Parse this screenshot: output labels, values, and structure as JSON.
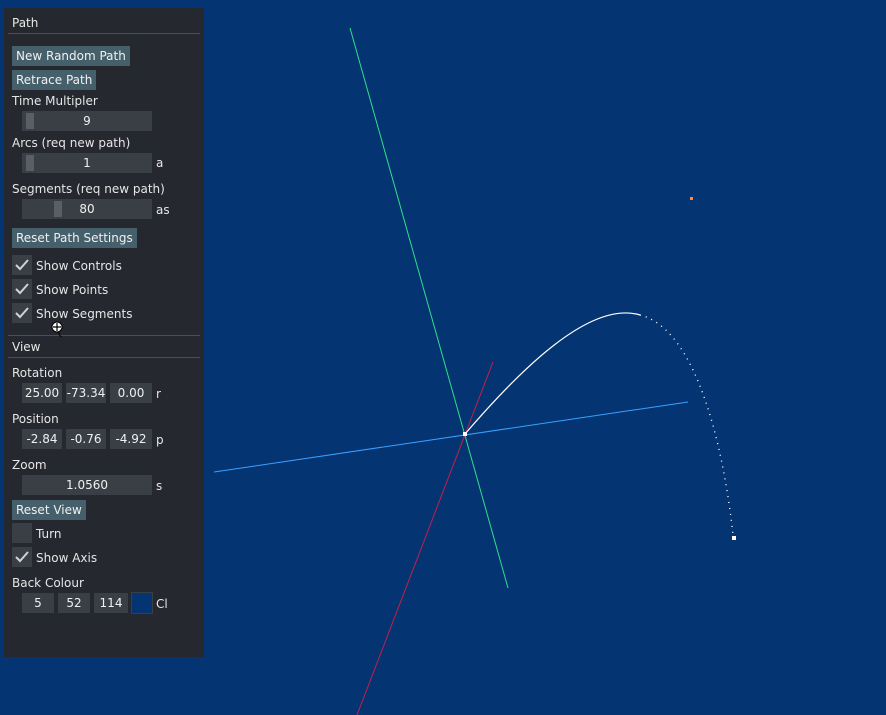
{
  "path_section": {
    "header": "Path",
    "new_random_path_label": "New Random Path",
    "retrace_path_label": "Retrace Path",
    "time_multiplier_label": "Time Multipler",
    "time_multiplier_value": "9",
    "arcs_label": "Arcs (req new path)",
    "arcs_value": "1",
    "arcs_suffix": "a",
    "segments_label": "Segments (req new path)",
    "segments_value": "80",
    "segments_suffix": "as",
    "reset_path_settings_label": "Reset Path Settings",
    "show_controls_label": "Show Controls",
    "show_controls_checked": true,
    "show_points_label": "Show Points",
    "show_points_checked": true,
    "show_segments_label": "Show Segments",
    "show_segments_checked": true
  },
  "view_section": {
    "header": "View",
    "rotation_label": "Rotation",
    "rotation_values": [
      "25.00",
      "-73.34",
      "0.00"
    ],
    "rotation_suffix": "r",
    "position_label": "Position",
    "position_values": [
      "-2.84",
      "-0.76",
      "-4.92"
    ],
    "position_suffix": "p",
    "zoom_label": "Zoom",
    "zoom_value": "1.0560",
    "zoom_suffix": "s",
    "reset_view_label": "Reset View",
    "turn_label": "Turn",
    "turn_checked": false,
    "show_axis_label": "Show Axis",
    "show_axis_checked": true,
    "back_colour_label": "Back Colour",
    "back_colour_values": [
      "5",
      "52",
      "114"
    ],
    "back_colour_suffix": "Cl"
  },
  "colors": {
    "background": "#053472",
    "panel": "#25282e",
    "button": "#46606b",
    "field": "#3a3e45",
    "axis_x": "#3aa0ff",
    "axis_y": "#2ee08a",
    "axis_z": "#c0204a",
    "path": "#ffffff",
    "control_point": "#ff8a3a"
  }
}
